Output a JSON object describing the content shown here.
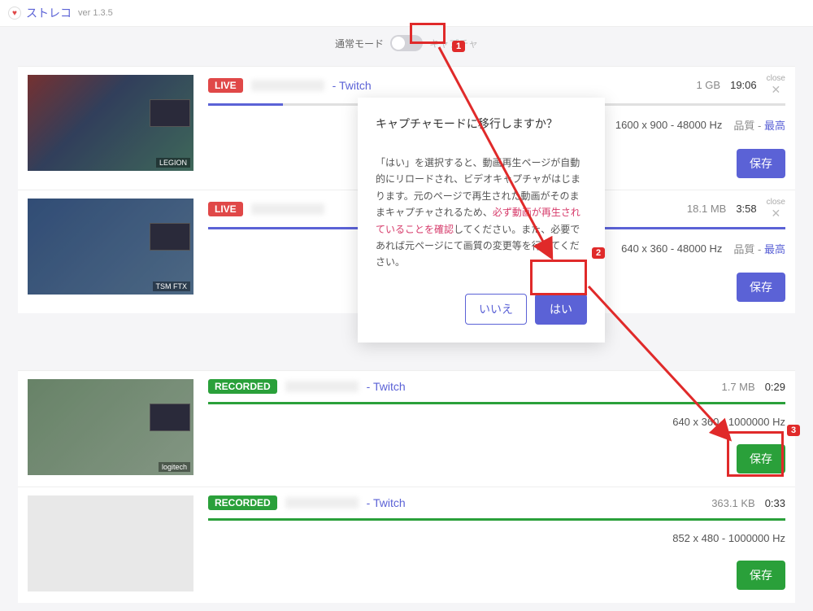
{
  "header": {
    "app_name": "ストレコ",
    "version": "ver 1.3.5"
  },
  "mode": {
    "left_label": "通常モード",
    "right_label": "キャプチャ"
  },
  "modal": {
    "title": "キャプチャモードに移行しますか？",
    "body_before": "「はい」を選択すると、動画再生ページが自動的にリロードされ、ビデオキャプチャがはじまります。元のページで再生された動画がそのままキャプチャされるため、",
    "body_warn": "必ず動画が再生されていることを確認",
    "body_after": "してください。また、必要であれば元ページにて画質の変更等を行ってください。",
    "no": "いいえ",
    "yes": "はい"
  },
  "common": {
    "source": " - Twitch",
    "quality_label": "品質 - ",
    "quality_value": "最高",
    "save": "保存",
    "close": "close"
  },
  "items": [
    {
      "badge": "LIVE",
      "size": "1 GB",
      "time": "19:06",
      "resolution": "1600 x 900 - 48000 Hz",
      "progress_pct": 13
    },
    {
      "badge": "LIVE",
      "size": "18.1 MB",
      "time": "3:58",
      "resolution": "640 x 360 - 48000 Hz",
      "progress_pct": 100
    },
    {
      "badge": "RECORDED",
      "size": "1.7 MB",
      "time": "0:29",
      "resolution": "640 x 360 - 1000000 Hz"
    },
    {
      "badge": "RECORDED",
      "size": "363.1 KB",
      "time": "0:33",
      "resolution": "852 x 480 - 1000000 Hz"
    }
  ],
  "annotations": {
    "n1": "1",
    "n2": "2",
    "n3": "3"
  }
}
